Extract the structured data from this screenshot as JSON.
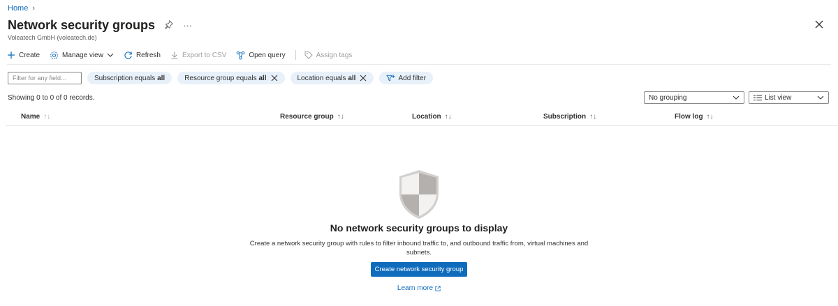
{
  "breadcrumb": {
    "home": "Home",
    "separator": "›"
  },
  "header": {
    "title": "Network security groups",
    "subtitle": "Voleatech GmbH (voleatech.de)",
    "more": "···"
  },
  "toolbar": {
    "create": "Create",
    "manage_view": "Manage view",
    "refresh": "Refresh",
    "export_csv": "Export to CSV",
    "open_query": "Open query",
    "assign_tags": "Assign tags"
  },
  "filters": {
    "placeholder": "Filter for any field...",
    "pills": [
      {
        "prefix": "Subscription equals",
        "value": "all"
      },
      {
        "prefix": "Resource group equals",
        "value": "all"
      },
      {
        "prefix": "Location equals",
        "value": "all"
      }
    ],
    "add_filter": "Add filter"
  },
  "records": "Showing 0 to 0 of 0 records.",
  "grouping": {
    "selected": "No grouping"
  },
  "view": {
    "selected": "List view"
  },
  "columns": [
    "Name",
    "Resource group",
    "Location",
    "Subscription",
    "Flow log"
  ],
  "empty_state": {
    "title": "No network security groups to display",
    "description": "Create a network security group with rules to filter inbound traffic to, and outbound traffic from, virtual machines and subnets.",
    "button": "Create network security group",
    "learn_more": "Learn more"
  },
  "colors": {
    "accent": "#0f6cbd",
    "pill_bg": "#e8f1fa"
  }
}
